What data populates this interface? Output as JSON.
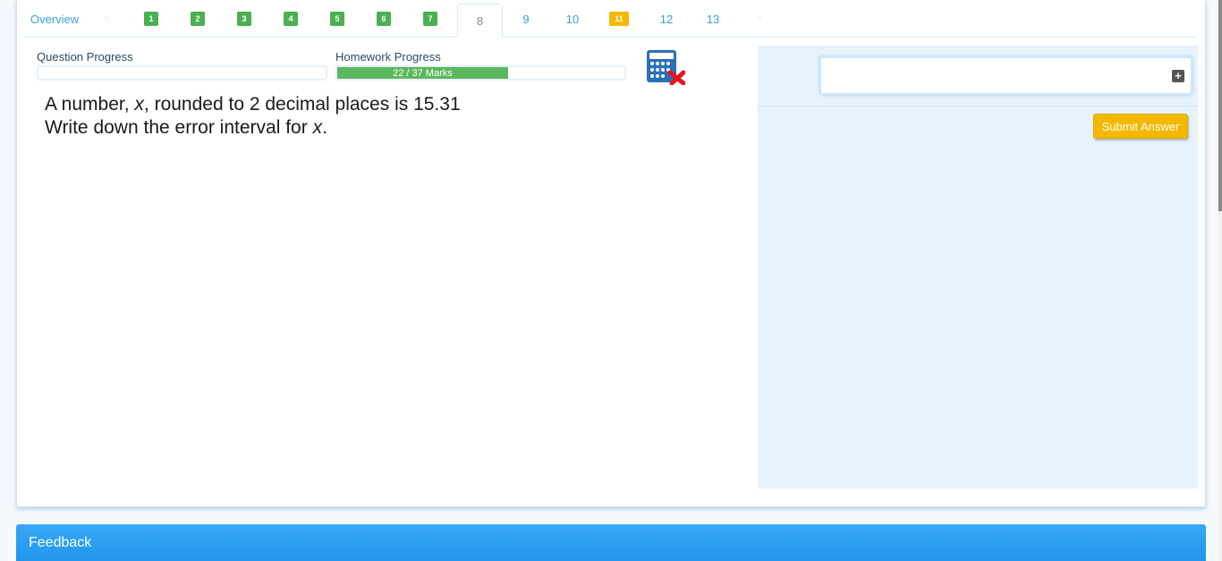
{
  "tabs": {
    "overview": "Overview",
    "prev_arrow": "«",
    "next_arrow": "»",
    "questions": [
      {
        "label": "1",
        "state": "complete"
      },
      {
        "label": "2",
        "state": "complete"
      },
      {
        "label": "3",
        "state": "complete"
      },
      {
        "label": "4",
        "state": "complete"
      },
      {
        "label": "5",
        "state": "complete"
      },
      {
        "label": "6",
        "state": "complete"
      },
      {
        "label": "7",
        "state": "complete"
      },
      {
        "label": "8",
        "state": "active"
      },
      {
        "label": "9",
        "state": "plain"
      },
      {
        "label": "10",
        "state": "plain"
      },
      {
        "label": "11",
        "state": "partial"
      },
      {
        "label": "12",
        "state": "plain"
      },
      {
        "label": "13",
        "state": "plain"
      }
    ]
  },
  "progress": {
    "question_label": "Question Progress",
    "question_fraction": 0,
    "homework_label": "Homework Progress",
    "homework_text": "22 / 37 Marks",
    "homework_fraction": 0.5946
  },
  "calculator": {
    "icon": "calculator-not-allowed-icon"
  },
  "question": {
    "line1_pre": "A number, ",
    "line1_var": "x",
    "line1_post": ", rounded to 2 decimal places is 15.31",
    "line2_pre": "Write down the error interval for ",
    "line2_var": "x",
    "line2_post": "."
  },
  "answer": {
    "input_value": "",
    "plus_icon": "plus-square-icon",
    "submit_label": "Submit Answer"
  },
  "feedback": {
    "title": "Feedback"
  },
  "colors": {
    "accent": "#3aa0d8",
    "complete": "#4caf50",
    "partial": "#f5b800",
    "feedback_bar": "#2a9ff0"
  }
}
